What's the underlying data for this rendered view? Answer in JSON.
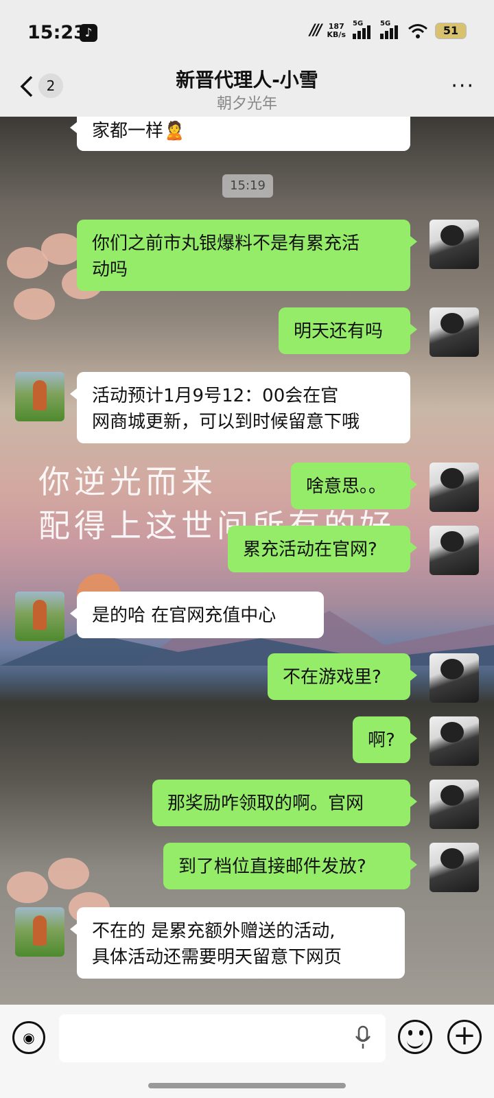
{
  "status_bar": {
    "time": "15:23",
    "net_speed_value": "187",
    "net_speed_unit": "KB/s",
    "signal1_label": "5G",
    "signal2_label": "5G",
    "battery": "51",
    "icons": [
      "tiktok-icon",
      "speed-icon",
      "signal-icon",
      "signal-icon",
      "wifi-icon",
      "battery-icon"
    ]
  },
  "header": {
    "back_badge": "2",
    "title": "新晋代理人-小雪",
    "subtitle": "朝夕光年",
    "more": "···"
  },
  "background_text": {
    "line1": "你逆光而来",
    "line2": "配得上这世间所有的好"
  },
  "chat": {
    "partial_top": "家都一样🙎",
    "timestamp": "15:19",
    "messages": [
      {
        "from": "me",
        "line1": "你们之前市丸银爆料不是有累充活",
        "line2": "动吗"
      },
      {
        "from": "me",
        "line1": "明天还有吗"
      },
      {
        "from": "them",
        "line1": "活动预计1月9号12：00会在官",
        "line2": "网商城更新，可以到时候留意下哦"
      },
      {
        "from": "me",
        "line1": "啥意思。。"
      },
      {
        "from": "me",
        "line1": "累充活动在官网?"
      },
      {
        "from": "them",
        "line1": "是的哈 在官网充值中心"
      },
      {
        "from": "me",
        "line1": "不在游戏里?"
      },
      {
        "from": "me",
        "line1": "啊?"
      },
      {
        "from": "me",
        "line1": "那奖励咋领取的啊。官网"
      },
      {
        "from": "me",
        "line1": "到了档位直接邮件发放?"
      },
      {
        "from": "them",
        "line1": "不在的 是累充额外赠送的活动,",
        "line2": "具体活动还需要明天留意下网页"
      }
    ]
  },
  "input_bar": {
    "value": "",
    "icons": [
      "voice-icon",
      "mic-icon",
      "emoji-icon",
      "plus-icon"
    ]
  }
}
